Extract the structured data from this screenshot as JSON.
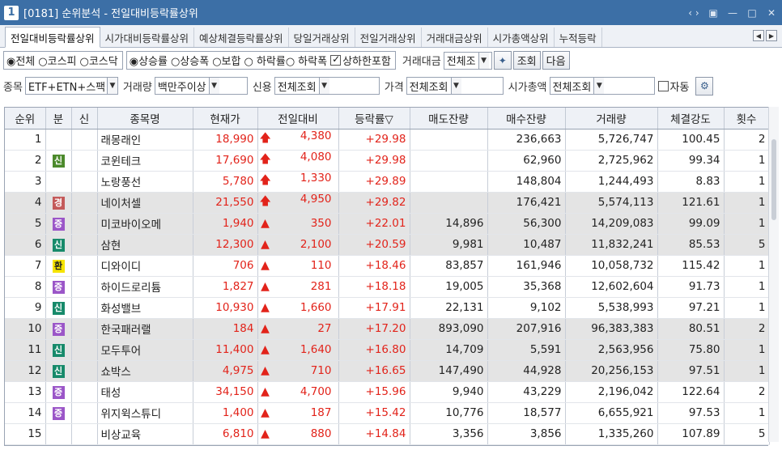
{
  "window": {
    "badge": "1",
    "title": "[0181] 순위분석 - 전일대비등락률상위",
    "controls": [
      "‹ ›",
      "▣",
      "—",
      "□",
      "✕"
    ]
  },
  "tabs": [
    "전일대비등락률상위",
    "시가대비등락률상위",
    "예상체결등락률상위",
    "당일거래상위",
    "전일거래상위",
    "거래대금상위",
    "시가총액상위",
    "누적등락"
  ],
  "filters": {
    "market": [
      "◉전체",
      "○코스피",
      "○코스닥"
    ],
    "sort": [
      "◉상승률",
      "○상승폭",
      "○보합",
      "○ 하락률○",
      "하락폭"
    ],
    "limit_label": "상하한포함",
    "amount_label": "거래대금",
    "amount_value": "전체조",
    "query_button": "조회",
    "next_button": "다음",
    "item_label": "종목",
    "item_value": "ETF+ETN+스팩",
    "volume_label": "거래량",
    "volume_value": "백만주이상",
    "credit_label": "신용",
    "credit_value": "전체조회",
    "price_label": "가격",
    "price_value": "전체조회",
    "cap_label": "시가총액",
    "cap_value": "전체조회",
    "auto_label": "자동"
  },
  "columns": [
    "순위",
    "분",
    "신",
    "종목명",
    "현재가",
    "전일대비",
    "등락률▽",
    "매도잔량",
    "매수잔량",
    "거래량",
    "체결강도",
    "횟수"
  ],
  "rows": [
    {
      "rank": "1",
      "badge": "",
      "badge_color": "",
      "name": "래몽래인",
      "price": "18,990",
      "arrow": "🡅",
      "change": "4,380",
      "rate": "+29.98",
      "ask": "",
      "bid": "236,663",
      "volume": "5,726,747",
      "strength": "100.45",
      "count": "2"
    },
    {
      "rank": "2",
      "badge": "신",
      "badge_color": "green",
      "name": "코윈테크",
      "price": "17,690",
      "arrow": "🡅",
      "change": "4,080",
      "rate": "+29.98",
      "ask": "",
      "bid": "62,960",
      "volume": "2,725,962",
      "strength": "99.34",
      "count": "1"
    },
    {
      "rank": "3",
      "badge": "",
      "badge_color": "",
      "name": "노랑풍선",
      "price": "5,780",
      "arrow": "🡅",
      "change": "1,330",
      "rate": "+29.89",
      "ask": "",
      "bid": "148,804",
      "volume": "1,244,493",
      "strength": "8.83",
      "count": "1"
    },
    {
      "rank": "4",
      "badge": "경",
      "badge_color": "red",
      "name": "네이처셀",
      "price": "21,550",
      "arrow": "🡅",
      "change": "4,950",
      "rate": "+29.82",
      "ask": "",
      "bid": "176,421",
      "volume": "5,574,113",
      "strength": "121.61",
      "count": "1"
    },
    {
      "rank": "5",
      "badge": "증",
      "badge_color": "purple",
      "name": "미코바이오메",
      "price": "1,940",
      "arrow": "▲",
      "change": "350",
      "rate": "+22.01",
      "ask": "14,896",
      "bid": "56,300",
      "volume": "14,209,083",
      "strength": "99.09",
      "count": "1"
    },
    {
      "rank": "6",
      "badge": "신",
      "badge_color": "teal",
      "name": "삼현",
      "price": "12,300",
      "arrow": "▲",
      "change": "2,100",
      "rate": "+20.59",
      "ask": "9,981",
      "bid": "10,487",
      "volume": "11,832,241",
      "strength": "85.53",
      "count": "5"
    },
    {
      "rank": "7",
      "badge": "환",
      "badge_color": "yellow",
      "name": "디와이디",
      "price": "706",
      "arrow": "▲",
      "change": "110",
      "rate": "+18.46",
      "ask": "83,857",
      "bid": "161,946",
      "volume": "10,058,732",
      "strength": "115.42",
      "count": "1"
    },
    {
      "rank": "8",
      "badge": "증",
      "badge_color": "purple",
      "name": "하이드로리튬",
      "price": "1,827",
      "arrow": "▲",
      "change": "281",
      "rate": "+18.18",
      "ask": "19,005",
      "bid": "35,368",
      "volume": "12,602,604",
      "strength": "91.73",
      "count": "1"
    },
    {
      "rank": "9",
      "badge": "신",
      "badge_color": "teal",
      "name": "화성밸브",
      "price": "10,930",
      "arrow": "▲",
      "change": "1,660",
      "rate": "+17.91",
      "ask": "22,131",
      "bid": "9,102",
      "volume": "5,538,993",
      "strength": "97.21",
      "count": "1"
    },
    {
      "rank": "10",
      "badge": "증",
      "badge_color": "purple",
      "name": "한국패러랠",
      "price": "184",
      "arrow": "▲",
      "change": "27",
      "rate": "+17.20",
      "ask": "893,090",
      "bid": "207,916",
      "volume": "96,383,383",
      "strength": "80.51",
      "count": "2"
    },
    {
      "rank": "11",
      "badge": "신",
      "badge_color": "teal",
      "name": "모두투어",
      "price": "11,400",
      "arrow": "▲",
      "change": "1,640",
      "rate": "+16.80",
      "ask": "14,709",
      "bid": "5,591",
      "volume": "2,563,956",
      "strength": "75.80",
      "count": "1"
    },
    {
      "rank": "12",
      "badge": "신",
      "badge_color": "teal",
      "name": "쇼박스",
      "price": "4,975",
      "arrow": "▲",
      "change": "710",
      "rate": "+16.65",
      "ask": "147,490",
      "bid": "44,928",
      "volume": "20,256,153",
      "strength": "97.51",
      "count": "1"
    },
    {
      "rank": "13",
      "badge": "증",
      "badge_color": "purple",
      "name": "태성",
      "price": "34,150",
      "arrow": "▲",
      "change": "4,700",
      "rate": "+15.96",
      "ask": "9,940",
      "bid": "43,229",
      "volume": "2,196,042",
      "strength": "122.64",
      "count": "2"
    },
    {
      "rank": "14",
      "badge": "증",
      "badge_color": "purple",
      "name": "위지윅스튜디",
      "price": "1,400",
      "arrow": "▲",
      "change": "187",
      "rate": "+15.42",
      "ask": "10,776",
      "bid": "18,577",
      "volume": "6,655,921",
      "strength": "97.53",
      "count": "1"
    },
    {
      "rank": "15",
      "badge": "",
      "badge_color": "",
      "name": "비상교육",
      "price": "6,810",
      "arrow": "▲",
      "change": "880",
      "rate": "+14.84",
      "ask": "3,356",
      "bid": "3,856",
      "volume": "1,335,260",
      "strength": "107.89",
      "count": "5"
    }
  ],
  "banded_rows": [
    3,
    4,
    5,
    9,
    10,
    11
  ],
  "colors": {
    "up": "#e2231a",
    "title_bar": "#3c6fa6"
  }
}
